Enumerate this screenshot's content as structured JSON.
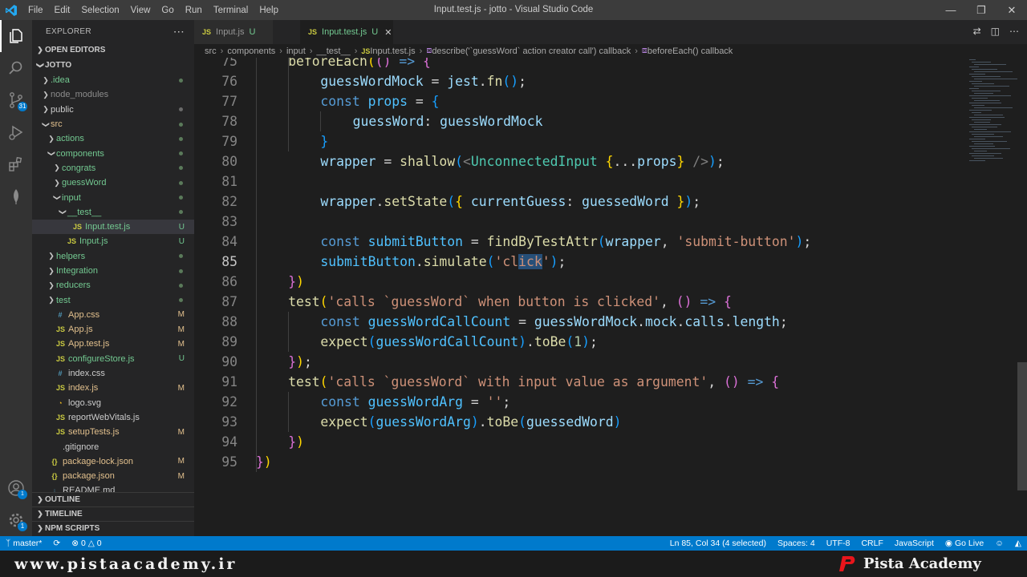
{
  "titlebar": {
    "menu": [
      "File",
      "Edit",
      "Selection",
      "View",
      "Go",
      "Run",
      "Terminal",
      "Help"
    ],
    "title": "Input.test.js - jotto - Visual Studio Code"
  },
  "activitybar": {
    "icons": [
      "explorer-icon",
      "search-icon",
      "source-control-icon",
      "run-debug-icon",
      "extensions-icon",
      "mongodb-icon",
      "account-icon",
      "settings-gear-icon"
    ],
    "source_control_badge": "31",
    "settings_badge": "1"
  },
  "sidebar": {
    "title": "EXPLORER",
    "open_editors": "OPEN EDITORS",
    "project": "JOTTO",
    "tree": [
      {
        "label": ".idea",
        "indent": 1,
        "chev": "closed",
        "type": "folder",
        "deco": "dot",
        "color": "#73c991"
      },
      {
        "label": "node_modules",
        "indent": 1,
        "chev": "closed",
        "type": "folder",
        "deco": "",
        "color": "#8c8c8c"
      },
      {
        "label": "public",
        "indent": 1,
        "chev": "closed",
        "type": "folder",
        "deco": "dot",
        "color": "#cccccc"
      },
      {
        "label": "src",
        "indent": 1,
        "chev": "open",
        "type": "folder",
        "deco": "dot",
        "color": "#e2c08d"
      },
      {
        "label": "actions",
        "indent": 2,
        "chev": "closed",
        "type": "folder",
        "deco": "dot",
        "color": "#73c991"
      },
      {
        "label": "components",
        "indent": 2,
        "chev": "open",
        "type": "folder",
        "deco": "dot",
        "color": "#73c991"
      },
      {
        "label": "congrats",
        "indent": 3,
        "chev": "closed",
        "type": "folder",
        "deco": "dot",
        "color": "#73c991"
      },
      {
        "label": "guessWord",
        "indent": 3,
        "chev": "closed",
        "type": "folder",
        "deco": "dot",
        "color": "#73c991"
      },
      {
        "label": "input",
        "indent": 3,
        "chev": "open",
        "type": "folder",
        "deco": "dot",
        "color": "#73c991"
      },
      {
        "label": "__test__",
        "indent": 4,
        "chev": "open",
        "type": "folder",
        "deco": "dot",
        "color": "#73c991"
      },
      {
        "label": "Input.test.js",
        "indent": 5,
        "chev": "",
        "type": "js",
        "deco": "U",
        "color": "#73c991",
        "selected": true
      },
      {
        "label": "Input.js",
        "indent": 4,
        "chev": "",
        "type": "js",
        "deco": "U",
        "color": "#73c991"
      },
      {
        "label": "helpers",
        "indent": 2,
        "chev": "closed",
        "type": "folder",
        "deco": "dot",
        "color": "#73c991"
      },
      {
        "label": "Integration",
        "indent": 2,
        "chev": "closed",
        "type": "folder",
        "deco": "dot",
        "color": "#73c991"
      },
      {
        "label": "reducers",
        "indent": 2,
        "chev": "closed",
        "type": "folder",
        "deco": "dot",
        "color": "#73c991"
      },
      {
        "label": "test",
        "indent": 2,
        "chev": "closed",
        "type": "folder",
        "deco": "dot",
        "color": "#73c991"
      },
      {
        "label": "App.css",
        "indent": 2,
        "chev": "",
        "type": "css",
        "deco": "M",
        "color": "#e2c08d"
      },
      {
        "label": "App.js",
        "indent": 2,
        "chev": "",
        "type": "js",
        "deco": "M",
        "color": "#e2c08d"
      },
      {
        "label": "App.test.js",
        "indent": 2,
        "chev": "",
        "type": "js",
        "deco": "M",
        "color": "#e2c08d"
      },
      {
        "label": "configureStore.js",
        "indent": 2,
        "chev": "",
        "type": "js",
        "deco": "U",
        "color": "#73c991"
      },
      {
        "label": "index.css",
        "indent": 2,
        "chev": "",
        "type": "css",
        "deco": "",
        "color": "#cccccc"
      },
      {
        "label": "index.js",
        "indent": 2,
        "chev": "",
        "type": "js",
        "deco": "M",
        "color": "#e2c08d"
      },
      {
        "label": "logo.svg",
        "indent": 2,
        "chev": "",
        "type": "svg",
        "deco": "",
        "color": "#cccccc"
      },
      {
        "label": "reportWebVitals.js",
        "indent": 2,
        "chev": "",
        "type": "js",
        "deco": "",
        "color": "#cccccc"
      },
      {
        "label": "setupTests.js",
        "indent": 2,
        "chev": "",
        "type": "js",
        "deco": "M",
        "color": "#e2c08d"
      },
      {
        "label": ".gitignore",
        "indent": 1,
        "chev": "",
        "type": "git",
        "deco": "",
        "color": "#cccccc"
      },
      {
        "label": "package-lock.json",
        "indent": 1,
        "chev": "",
        "type": "json",
        "deco": "M",
        "color": "#e2c08d"
      },
      {
        "label": "package.json",
        "indent": 1,
        "chev": "",
        "type": "json",
        "deco": "M",
        "color": "#e2c08d"
      },
      {
        "label": "README.md",
        "indent": 1,
        "chev": "",
        "type": "md",
        "deco": "",
        "color": "#cccccc"
      }
    ],
    "outline": "OUTLINE",
    "timeline": "TIMELINE",
    "npm_scripts": "NPM SCRIPTS"
  },
  "tabs": [
    {
      "label": "Input.js",
      "status": "U",
      "active": false
    },
    {
      "label": "Input.test.js",
      "status": "U",
      "active": true
    }
  ],
  "breadcrumb": [
    "src",
    "components",
    "input",
    "__test__",
    "Input.test.js",
    "describe('`guessWord` action creator call') callback",
    "beforeEach() callback"
  ],
  "editor": {
    "current_line": 85,
    "lines": [
      {
        "n": "75",
        "indent": 1,
        "tokens": [
          [
            "fn",
            "beforeEach"
          ],
          [
            "brk1",
            "("
          ],
          [
            "brk2",
            "("
          ],
          [
            "brk2",
            ")"
          ],
          [
            "plain",
            " "
          ],
          [
            "kw",
            "=>"
          ],
          [
            "plain",
            " "
          ],
          [
            "brk2",
            "{"
          ]
        ]
      },
      {
        "n": "76",
        "indent": 2,
        "tokens": [
          [
            "var",
            "guessWordMock"
          ],
          [
            "plain",
            " = "
          ],
          [
            "var",
            "jest"
          ],
          [
            "plain",
            "."
          ],
          [
            "fn",
            "fn"
          ],
          [
            "brk3",
            "("
          ],
          [
            "brk3",
            ")"
          ],
          [
            "plain",
            ";"
          ]
        ]
      },
      {
        "n": "77",
        "indent": 2,
        "tokens": [
          [
            "kw",
            "const"
          ],
          [
            "plain",
            " "
          ],
          [
            "const",
            "props"
          ],
          [
            "plain",
            " = "
          ],
          [
            "brk3",
            "{"
          ]
        ]
      },
      {
        "n": "78",
        "indent": 3,
        "tokens": [
          [
            "var",
            "guessWord"
          ],
          [
            "plain",
            ": "
          ],
          [
            "var",
            "guessWordMock"
          ]
        ]
      },
      {
        "n": "79",
        "indent": 2,
        "tokens": [
          [
            "brk3",
            "}"
          ]
        ]
      },
      {
        "n": "80",
        "indent": 2,
        "tokens": [
          [
            "var",
            "wrapper"
          ],
          [
            "plain",
            " = "
          ],
          [
            "fn",
            "shallow"
          ],
          [
            "brk3",
            "("
          ],
          [
            "tag",
            "<"
          ],
          [
            "comp",
            "UnconnectedInput"
          ],
          [
            "plain",
            " "
          ],
          [
            "brk1",
            "{"
          ],
          [
            "plain",
            "..."
          ],
          [
            "var",
            "props"
          ],
          [
            "brk1",
            "}"
          ],
          [
            "plain",
            " "
          ],
          [
            "tag",
            "/>"
          ],
          [
            "brk3",
            ")"
          ],
          [
            "plain",
            ";"
          ]
        ]
      },
      {
        "n": "81",
        "indent": 0,
        "tokens": []
      },
      {
        "n": "82",
        "indent": 2,
        "tokens": [
          [
            "var",
            "wrapper"
          ],
          [
            "plain",
            "."
          ],
          [
            "fn",
            "setState"
          ],
          [
            "brk3",
            "("
          ],
          [
            "brk1",
            "{"
          ],
          [
            "plain",
            " "
          ],
          [
            "var",
            "currentGuess"
          ],
          [
            "plain",
            ": "
          ],
          [
            "var",
            "guessedWord"
          ],
          [
            "plain",
            " "
          ],
          [
            "brk1",
            "}"
          ],
          [
            "brk3",
            ")"
          ],
          [
            "plain",
            ";"
          ]
        ]
      },
      {
        "n": "83",
        "indent": 0,
        "tokens": []
      },
      {
        "n": "84",
        "indent": 2,
        "tokens": [
          [
            "kw",
            "const"
          ],
          [
            "plain",
            " "
          ],
          [
            "const",
            "submitButton"
          ],
          [
            "plain",
            " = "
          ],
          [
            "fn",
            "findByTestAttr"
          ],
          [
            "brk3",
            "("
          ],
          [
            "var",
            "wrapper"
          ],
          [
            "plain",
            ", "
          ],
          [
            "str",
            "'submit-button'"
          ],
          [
            "brk3",
            ")"
          ],
          [
            "plain",
            ";"
          ]
        ]
      },
      {
        "n": "85",
        "indent": 2,
        "tokens": [
          [
            "const",
            "submitButton"
          ],
          [
            "plain",
            "."
          ],
          [
            "fn",
            "simulate"
          ],
          [
            "brk3",
            "("
          ],
          [
            "str",
            "'cl"
          ],
          [
            "str_sel",
            "ick"
          ],
          [
            "str",
            "'"
          ],
          [
            "brk3",
            ")"
          ],
          [
            "plain",
            ";"
          ]
        ]
      },
      {
        "n": "86",
        "indent": 1,
        "tokens": [
          [
            "brk2",
            "}"
          ],
          [
            "brk1",
            ")"
          ]
        ]
      },
      {
        "n": "87",
        "indent": 1,
        "tokens": [
          [
            "fn",
            "test"
          ],
          [
            "brk1",
            "("
          ],
          [
            "str",
            "'calls `guessWord` when button is clicked'"
          ],
          [
            "plain",
            ", "
          ],
          [
            "brk2",
            "("
          ],
          [
            "brk2",
            ")"
          ],
          [
            "plain",
            " "
          ],
          [
            "kw",
            "=>"
          ],
          [
            "plain",
            " "
          ],
          [
            "brk2",
            "{"
          ]
        ]
      },
      {
        "n": "88",
        "indent": 2,
        "tokens": [
          [
            "kw",
            "const"
          ],
          [
            "plain",
            " "
          ],
          [
            "const",
            "guessWordCallCount"
          ],
          [
            "plain",
            " = "
          ],
          [
            "var",
            "guessWordMock"
          ],
          [
            "plain",
            "."
          ],
          [
            "var",
            "mock"
          ],
          [
            "plain",
            "."
          ],
          [
            "var",
            "calls"
          ],
          [
            "plain",
            "."
          ],
          [
            "var",
            "length"
          ],
          [
            "plain",
            ";"
          ]
        ]
      },
      {
        "n": "89",
        "indent": 2,
        "tokens": [
          [
            "fn",
            "expect"
          ],
          [
            "brk3",
            "("
          ],
          [
            "const",
            "guessWordCallCount"
          ],
          [
            "brk3",
            ")"
          ],
          [
            "plain",
            "."
          ],
          [
            "fn",
            "toBe"
          ],
          [
            "brk3",
            "("
          ],
          [
            "num",
            "1"
          ],
          [
            "brk3",
            ")"
          ],
          [
            "plain",
            ";"
          ]
        ]
      },
      {
        "n": "90",
        "indent": 1,
        "tokens": [
          [
            "brk2",
            "}"
          ],
          [
            "brk1",
            ")"
          ],
          [
            "plain",
            ";"
          ]
        ]
      },
      {
        "n": "91",
        "indent": 1,
        "tokens": [
          [
            "fn",
            "test"
          ],
          [
            "brk1",
            "("
          ],
          [
            "str",
            "'calls `guessWord` with input value as argument'"
          ],
          [
            "plain",
            ", "
          ],
          [
            "brk2",
            "("
          ],
          [
            "brk2",
            ")"
          ],
          [
            "plain",
            " "
          ],
          [
            "kw",
            "=>"
          ],
          [
            "plain",
            " "
          ],
          [
            "brk2",
            "{"
          ]
        ]
      },
      {
        "n": "92",
        "indent": 2,
        "tokens": [
          [
            "kw",
            "const"
          ],
          [
            "plain",
            " "
          ],
          [
            "const",
            "guessWordArg"
          ],
          [
            "plain",
            " = "
          ],
          [
            "str",
            "''"
          ],
          [
            "plain",
            ";"
          ]
        ]
      },
      {
        "n": "93",
        "indent": 2,
        "tokens": [
          [
            "fn",
            "expect"
          ],
          [
            "brk3",
            "("
          ],
          [
            "const",
            "guessWordArg"
          ],
          [
            "brk3",
            ")"
          ],
          [
            "plain",
            "."
          ],
          [
            "fn",
            "toBe"
          ],
          [
            "brk3",
            "("
          ],
          [
            "var",
            "guessedWord"
          ],
          [
            "brk3",
            ")"
          ]
        ]
      },
      {
        "n": "94",
        "indent": 1,
        "tokens": [
          [
            "brk2",
            "}"
          ],
          [
            "brk1",
            ")"
          ]
        ]
      },
      {
        "n": "95",
        "indent": 0,
        "tokens": [
          [
            "brk2",
            "}"
          ],
          [
            "brk1",
            ")"
          ]
        ]
      }
    ]
  },
  "statusbar": {
    "branch": "master*",
    "sync": "",
    "problems": "0",
    "warnings": "0",
    "position": "Ln 85, Col 34 (4 selected)",
    "spaces": "Spaces: 4",
    "encoding": "UTF-8",
    "eol": "CRLF",
    "language": "JavaScript",
    "golive": "Go Live"
  },
  "watermark": {
    "url": "www.pistaacademy.ir",
    "brand": "Pista Academy",
    "logo_color": "#e8151b"
  }
}
